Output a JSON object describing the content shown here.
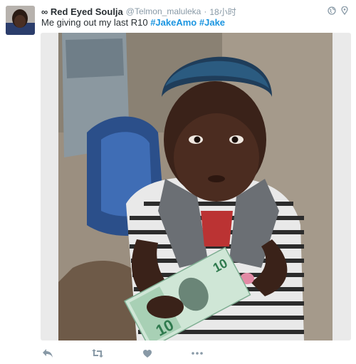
{
  "tweet": {
    "author_name": "Red Eyed Soulja",
    "author_prefix": "∞",
    "handle": "@Telmon_maluleka",
    "separator": "·",
    "time": "18小时",
    "text": "Me giving out my last R10",
    "hashtags": [
      "#JakeAmo",
      "#Jake"
    ],
    "banknote_value": "10"
  },
  "icons": {
    "header": [
      "globe-icon",
      "location-pin-icon"
    ],
    "actions": [
      "reply-icon",
      "retweet-icon",
      "like-icon",
      "more-icon"
    ]
  },
  "colors": {
    "text": "#292f33",
    "secondary": "#8899a6",
    "hashtag": "#1b95e0",
    "media_bg": "#eaeaea"
  }
}
